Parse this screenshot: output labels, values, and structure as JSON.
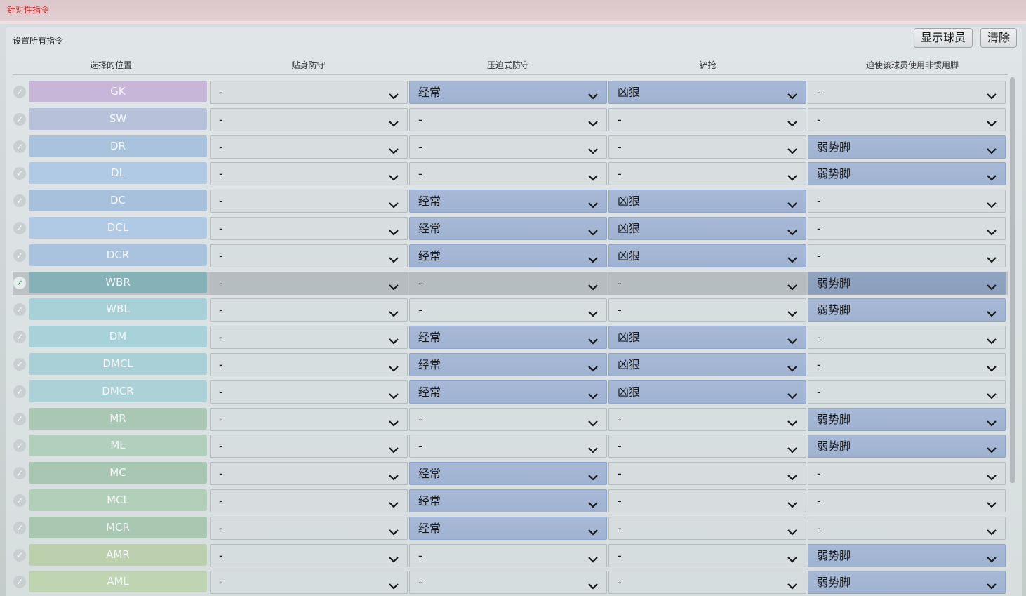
{
  "window": {
    "title": "针对性指令"
  },
  "toolbar": {
    "set_all_label": "设置所有指令",
    "show_players_label": "显示球员",
    "clear_label": "清除"
  },
  "columns": [
    "选择的位置",
    "贴身防守",
    "压迫式防守",
    "铲抢",
    "迫使该球员使用非惯用脚"
  ],
  "colors": {
    "title_text": "#d42a2a",
    "highlight_dropdown": "#a7b9d6",
    "check_selected": "#25a060"
  },
  "icons": {
    "row_check": "check-icon",
    "dropdown": "chevron-down-icon"
  },
  "rows": [
    {
      "pos": "GK",
      "color": "#c7b6d8",
      "selected": false,
      "values": [
        "-",
        "经常",
        "凶狠",
        "-"
      ]
    },
    {
      "pos": "SW",
      "color": "#b7c1d9",
      "selected": false,
      "values": [
        "-",
        "-",
        "-",
        "-"
      ]
    },
    {
      "pos": "DR",
      "color": "#a9c2de",
      "selected": false,
      "values": [
        "-",
        "-",
        "-",
        "弱势脚"
      ]
    },
    {
      "pos": "DL",
      "color": "#b0c9e4",
      "selected": false,
      "values": [
        "-",
        "-",
        "-",
        "弱势脚"
      ]
    },
    {
      "pos": "DC",
      "color": "#a7c0dc",
      "selected": false,
      "values": [
        "-",
        "经常",
        "凶狠",
        "-"
      ]
    },
    {
      "pos": "DCL",
      "color": "#b0c9e4",
      "selected": false,
      "values": [
        "-",
        "经常",
        "凶狠",
        "-"
      ]
    },
    {
      "pos": "DCR",
      "color": "#a9c3de",
      "selected": false,
      "values": [
        "-",
        "经常",
        "凶狠",
        "-"
      ]
    },
    {
      "pos": "WBR",
      "color": "#84b2b7",
      "selected": true,
      "values": [
        "-",
        "-",
        "-",
        "弱势脚"
      ]
    },
    {
      "pos": "WBL",
      "color": "#a7d1d7",
      "selected": false,
      "values": [
        "-",
        "-",
        "-",
        "弱势脚"
      ]
    },
    {
      "pos": "DM",
      "color": "#a8d2d9",
      "selected": false,
      "values": [
        "-",
        "经常",
        "凶狠",
        "-"
      ]
    },
    {
      "pos": "DMCL",
      "color": "#a9d0d7",
      "selected": false,
      "values": [
        "-",
        "经常",
        "凶狠",
        "-"
      ]
    },
    {
      "pos": "DMCR",
      "color": "#acd2d8",
      "selected": false,
      "values": [
        "-",
        "经常",
        "凶狠",
        "-"
      ]
    },
    {
      "pos": "MR",
      "color": "#a9c7b3",
      "selected": false,
      "values": [
        "-",
        "-",
        "-",
        "弱势脚"
      ]
    },
    {
      "pos": "ML",
      "color": "#b1d0bb",
      "selected": false,
      "values": [
        "-",
        "-",
        "-",
        "弱势脚"
      ]
    },
    {
      "pos": "MC",
      "color": "#a8c7b2",
      "selected": false,
      "values": [
        "-",
        "经常",
        "-",
        "-"
      ]
    },
    {
      "pos": "MCL",
      "color": "#b2cfba",
      "selected": false,
      "values": [
        "-",
        "经常",
        "-",
        "-"
      ]
    },
    {
      "pos": "MCR",
      "color": "#a8c8b1",
      "selected": false,
      "values": [
        "-",
        "经常",
        "-",
        "-"
      ]
    },
    {
      "pos": "AMR",
      "color": "#bcd0ae",
      "selected": false,
      "values": [
        "-",
        "-",
        "-",
        "弱势脚"
      ]
    },
    {
      "pos": "AML",
      "color": "#bfd4b1",
      "selected": false,
      "values": [
        "-",
        "-",
        "-",
        "弱势脚"
      ]
    }
  ]
}
